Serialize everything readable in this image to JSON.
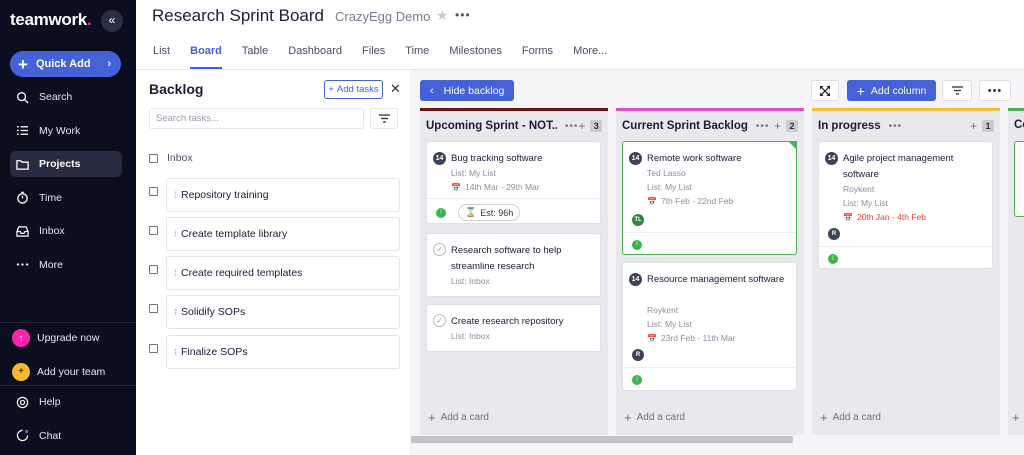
{
  "sidebar": {
    "logo_text": "teamwork",
    "logo_dot": ".",
    "collapse_label": "«",
    "quick_add_label": "Quick Add",
    "items": [
      {
        "label": "Search",
        "icon": "search-icon"
      },
      {
        "label": "My Work",
        "icon": "list-icon"
      },
      {
        "label": "Projects",
        "icon": "folder-icon",
        "active": true
      },
      {
        "label": "Time",
        "icon": "clock-icon"
      },
      {
        "label": "Inbox",
        "icon": "inbox-icon"
      },
      {
        "label": "More",
        "icon": "ellipsis-icon"
      }
    ],
    "upgrade_label": "Upgrade now",
    "add_team_label": "Add your team",
    "help_label": "Help",
    "chat_label": "Chat",
    "colors": {
      "bg": "#0b0e1f",
      "accent": "#4461d7",
      "upgrade": "#ff22b1",
      "team": "#f7b731"
    }
  },
  "header": {
    "title": "Research Sprint Board",
    "project": "CrazyEgg Demo",
    "tabs": [
      "List",
      "Board",
      "Table",
      "Dashboard",
      "Files",
      "Time",
      "Milestones",
      "Forms",
      "More..."
    ],
    "active_tab": "Board"
  },
  "backlog": {
    "title": "Backlog",
    "add_tasks_label": "Add tasks",
    "search_placeholder": "Search tasks...",
    "inbox_label": "Inbox",
    "tasks": [
      "Repository training",
      "Create template library",
      "Create required templates",
      "Solidify SOPs",
      "Finalize SOPs"
    ]
  },
  "board": {
    "hide_backlog_label": "Hide backlog",
    "add_column_label": "Add column",
    "add_card_label": "Add a card",
    "columns": [
      {
        "name": "Upcoming Sprint - NOT...",
        "count": "3",
        "color": "#6b1414",
        "cards": [
          {
            "title": "Bug tracking software",
            "priority": "14",
            "list": "List: My List",
            "date": "14th Mar - 29th Mar",
            "estimate": "Est: 96h"
          },
          {
            "title": "Research software to help streamline research",
            "list": "List: Inbox"
          },
          {
            "title": "Create research repository",
            "list": "List: Inbox"
          }
        ]
      },
      {
        "name": "Current Sprint Backlog",
        "count": "2",
        "color": "#e04cc4",
        "cards": [
          {
            "title": "Remote work software",
            "priority": "14",
            "assignee": "Ted Lasso",
            "list": "List: My List",
            "date": "7th Feb - 22nd Feb",
            "avatar": "TL"
          },
          {
            "title": "Resource management software",
            "priority": "14",
            "assignee": "Roykent",
            "list": "List: My List",
            "date": "23rd Feb - 11th Mar",
            "avatar": "R"
          }
        ]
      },
      {
        "name": "In progress",
        "count": "1",
        "color": "#f2c033",
        "cards": [
          {
            "title": "Agile project management software",
            "priority": "14",
            "assignee": "Roykent",
            "list": "List: My List",
            "date": "20th Jan - 4th Feb",
            "avatar": "R"
          }
        ]
      }
    ],
    "partial_column_label": "Co"
  }
}
